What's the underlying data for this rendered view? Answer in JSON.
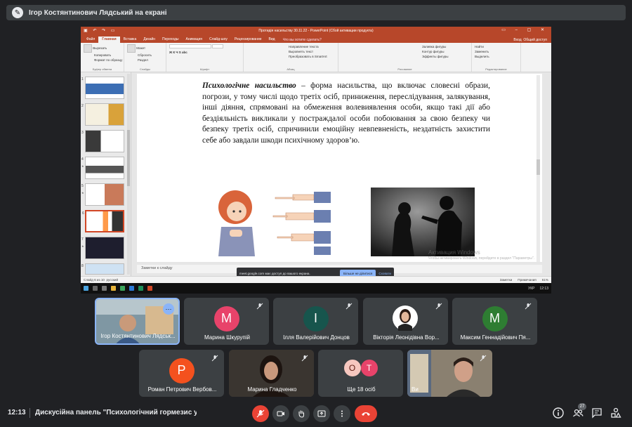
{
  "banner": {
    "text": "Ігор Костянтинович Лядський на екрані"
  },
  "ppt": {
    "window_title": "Протидія насильству 30.11.22 - PowerPoint (Сбой активации продукта)",
    "tabs": [
      "Файл",
      "Главная",
      "Вставка",
      "Дизайн",
      "Переходы",
      "Анимация",
      "Слайд-шоу",
      "Рецензирование",
      "Вид"
    ],
    "active_tab": "Главная",
    "tell_me": "Что вы хотите сделать?",
    "signin": "Вход",
    "share": "Общий доступ",
    "ribbon": {
      "clipboard": {
        "paste": "Вставить",
        "cut": "Вырезать",
        "copy": "Копировать",
        "format": "Формат по образцу",
        "label": "Буфер обмена"
      },
      "slides": {
        "new": "Создать слайд",
        "layout": "Макет",
        "reset": "Сбросить",
        "section": "Раздел",
        "label": "Слайды"
      },
      "font": {
        "label": "Шрифт"
      },
      "paragraph": {
        "direction": "Направление текста",
        "align": "Выровнять текст",
        "smartart": "Преобразовать в SmartArt",
        "label": "Абзац"
      },
      "drawing": {
        "arrange": "Упорядочить",
        "quick": "Экспресс-стили",
        "fill": "Заливка фигуры",
        "outline": "Контур фигуры",
        "effects": "Эффекты фигуры",
        "label": "Рисование"
      },
      "editing": {
        "find": "Найти",
        "replace": "Заменить",
        "select": "Выделить",
        "label": "Редактирование"
      }
    },
    "slide_numbers": [
      "1",
      "2",
      "3",
      "4",
      "5",
      "6",
      "7",
      "8"
    ],
    "slide_text": {
      "term": "Психологічне насильство",
      "body": " – форма насильства, що включає словесні образи, погрози, у тому числі щодо третіх осіб, приниження, переслідування, залякування, інші діяння, спрямовані на обмеження волевиявлення особи, якщо такі дії або бездіяльність викликали у постраждалої особи побоювання за свою безпеку чи безпеку третіх осіб, спричинили емоційну невпевненість, нездатність захистити себе або завдали шкоди психічному здоров’ю."
    },
    "notes_placeholder": "Заметки к слайду",
    "watermark": {
      "title": "Активация Windows",
      "sub": "Чтобы активировать Windows, перейдите в раздел \"Параметры\"."
    },
    "share_bar": {
      "message": "meet.google.com має доступ до вашого екрана.",
      "stop": "Більше не ділитися",
      "hide": "Сховати"
    },
    "status": {
      "slide": "Слайд 6 из 10",
      "lang": "русский",
      "notes": "Заметки",
      "comments": "Примечания",
      "zoom": "61%"
    },
    "taskbar": {
      "lang": "УКР",
      "time": "12:13"
    }
  },
  "participants": [
    {
      "name": "Ігор Костянтинович Лядськ...",
      "initial": "",
      "color": "#6b7c86",
      "self": true
    },
    {
      "name": "Марина Шкурупій",
      "initial": "М",
      "color": "#e8436a"
    },
    {
      "name": "Ілля Валерійович Донцов",
      "initial": "І",
      "color": "#17554d"
    },
    {
      "name": "Вікторія Леонідівна Вор...",
      "initial": "",
      "color": "#ffffff"
    },
    {
      "name": "Максим Геннадійович Пя...",
      "initial": "М",
      "color": "#2e7d32"
    },
    {
      "name": "Роман Петрович Вербов...",
      "initial": "Р",
      "color": "#f4511e"
    },
    {
      "name": "Марина Гладченко",
      "initial": "",
      "color": "#4a4035"
    },
    {
      "name": "Ще 18 осіб",
      "initial": "",
      "color": "#3c4043"
    },
    {
      "name": "Ви",
      "initial": "",
      "color": "#8a8070"
    }
  ],
  "more_avatars": [
    "О",
    "Т"
  ],
  "bottom": {
    "time": "12:13",
    "meeting_title": "Дискусійна панель \"Психологічний гормезис у пр...",
    "participants_count": "27"
  },
  "colors": {
    "accent": "#8ab4f8",
    "end_call": "#ea4335",
    "ppt": "#b7472a"
  }
}
